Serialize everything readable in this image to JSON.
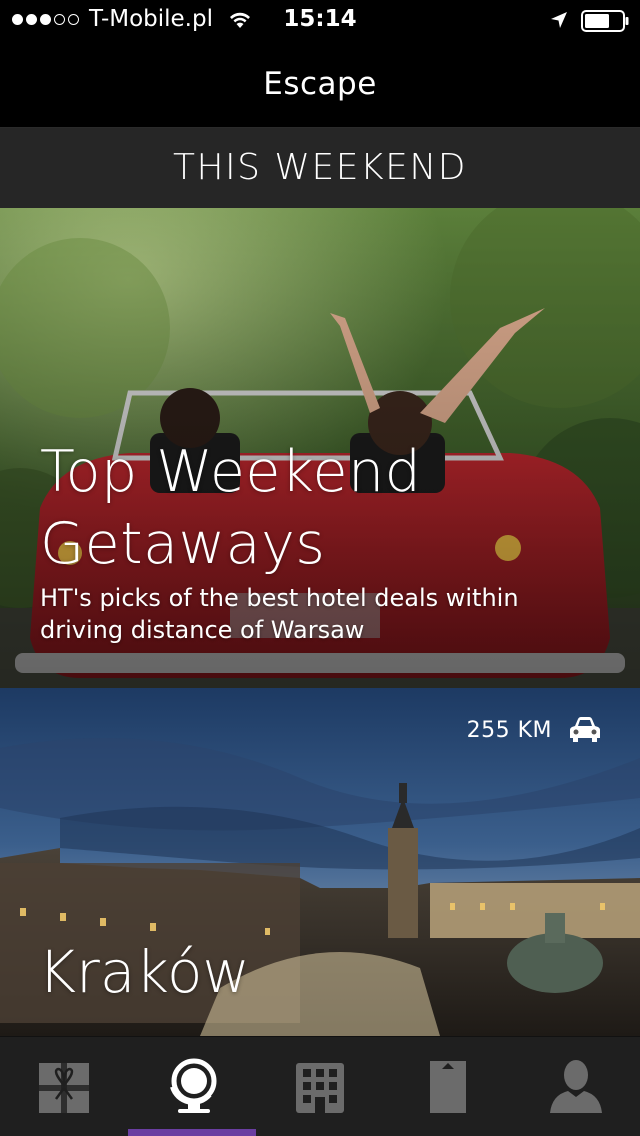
{
  "status_bar": {
    "carrier": "T-Mobile.pl",
    "time": "15:14",
    "signal_bars": 3,
    "signal_total": 5
  },
  "nav": {
    "title": "Escape"
  },
  "section": {
    "title": "THIS WEEKEND"
  },
  "hero_card": {
    "title_line1": "Top Weekend",
    "title_line2": "Getaways",
    "subtitle_line1": "HT's picks of the best hotel deals within",
    "subtitle_line2": "driving distance of Warsaw"
  },
  "destination_card": {
    "distance": "255 KM",
    "city": "Kraków",
    "transport_icon": "car-icon"
  },
  "tabs": [
    {
      "icon": "gift-icon",
      "active": false
    },
    {
      "icon": "globe-icon",
      "active": true
    },
    {
      "icon": "building-icon",
      "active": false
    },
    {
      "icon": "bookmark-icon",
      "active": false
    },
    {
      "icon": "person-icon",
      "active": false
    }
  ],
  "colors": {
    "accent": "#6a3ea1",
    "tab_bar": "#1f1f1f",
    "section_header": "#262626",
    "inactive_icon": "#6b6b6b"
  }
}
